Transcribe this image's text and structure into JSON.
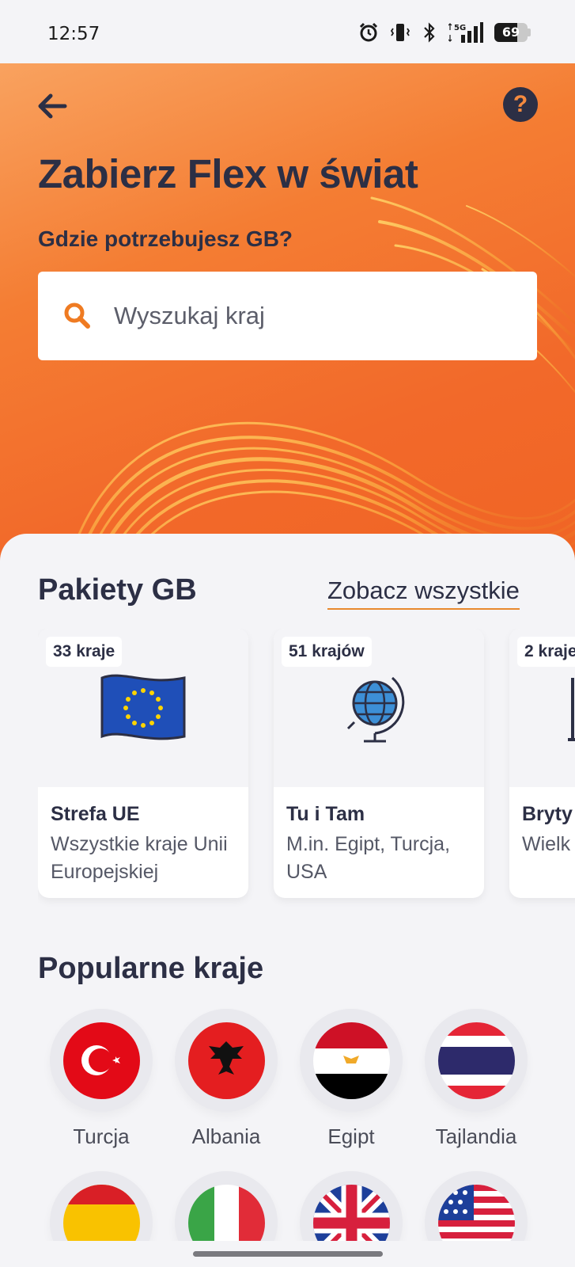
{
  "status_bar": {
    "time": "12:57",
    "battery": "69",
    "battery_level": 0.69,
    "network": "5G"
  },
  "header": {
    "back_icon": "arrow-left-icon",
    "help_icon": "question-icon",
    "help_glyph": "?",
    "title": "Zabierz Flex w świat",
    "subtitle": "Gdzie potrzebujesz GB?"
  },
  "search": {
    "icon": "search-icon",
    "placeholder": "Wyszukaj kraj"
  },
  "packages": {
    "title": "Pakiety GB",
    "see_all": "Zobacz wszystkie",
    "cards": [
      {
        "badge": "33 kraje",
        "icon": "eu-flag-icon",
        "name": "Strefa UE",
        "desc": "Wszystkie kraje Unii Europejskiej"
      },
      {
        "badge": "51 krajów",
        "icon": "globe-icon",
        "name": "Tu i Tam",
        "desc": "M.in. Egipt, Turcja, USA"
      },
      {
        "badge": "2 kraje",
        "icon": "phone-booth-icon",
        "name": "Bryty",
        "desc": "Wielk Gibra"
      }
    ]
  },
  "popular": {
    "title": "Popularne kraje",
    "countries": [
      {
        "name": "Turcja",
        "flag": "turkey-flag-icon"
      },
      {
        "name": "Albania",
        "flag": "albania-flag-icon"
      },
      {
        "name": "Egipt",
        "flag": "egypt-flag-icon"
      },
      {
        "name": "Tajlandia",
        "flag": "thailand-flag-icon"
      },
      {
        "name": "",
        "flag": "spain-flag-icon"
      },
      {
        "name": "",
        "flag": "italy-flag-icon"
      },
      {
        "name": "",
        "flag": "uk-flag-icon"
      },
      {
        "name": "",
        "flag": "usa-flag-icon"
      }
    ]
  },
  "colors": {
    "accent": "#f47d33",
    "text_dark": "#2c2f45",
    "underline": "#e8892d"
  }
}
